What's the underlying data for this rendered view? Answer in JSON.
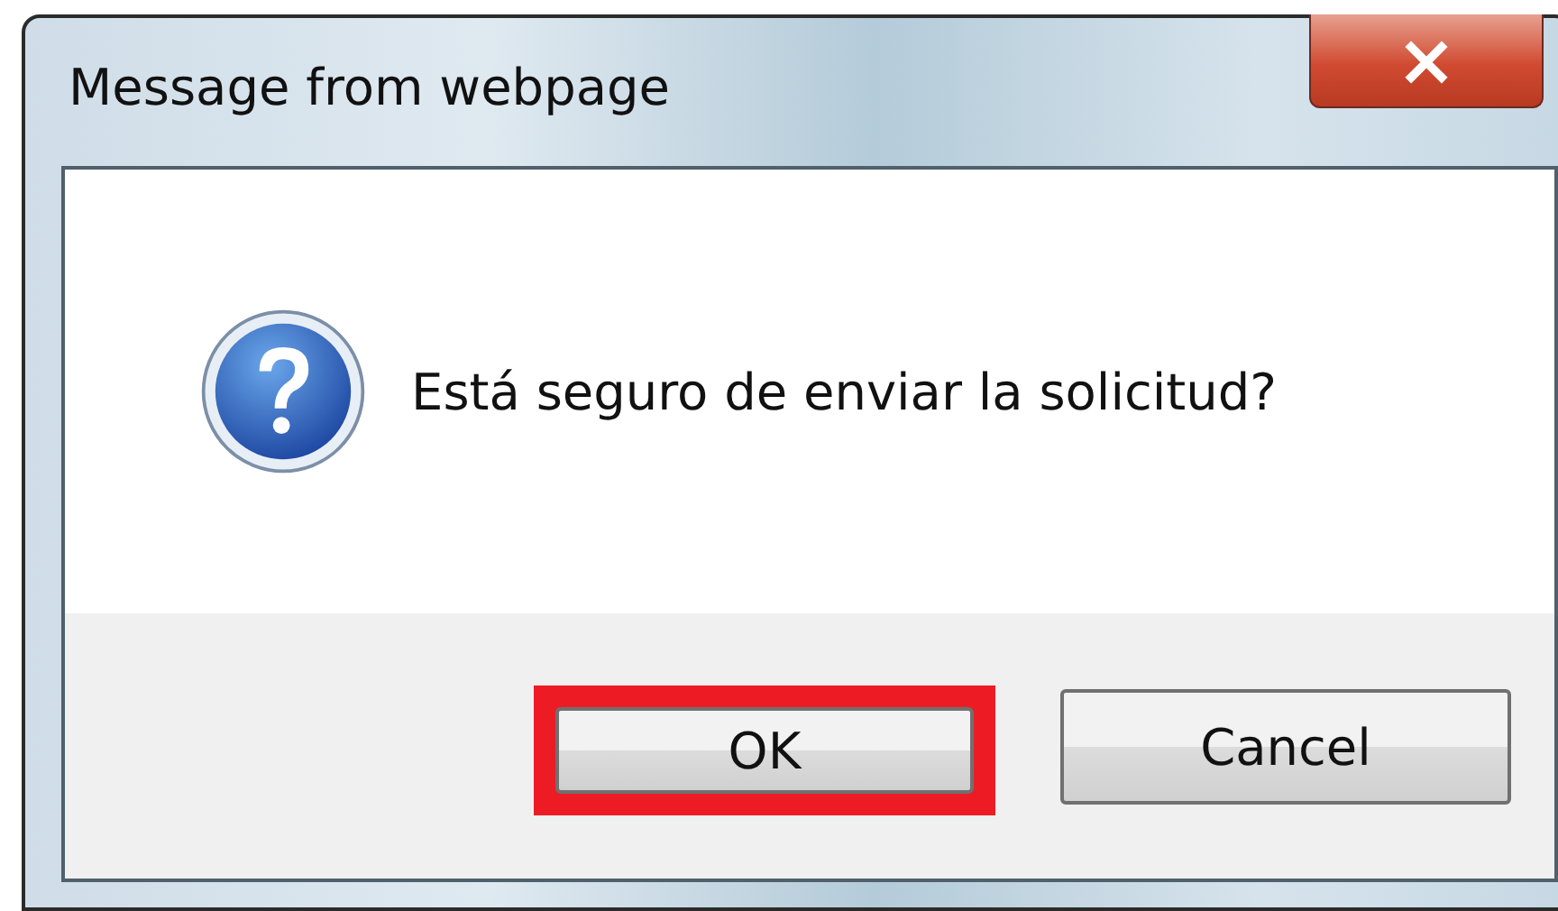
{
  "window": {
    "title": "Message from webpage",
    "close_glyph": "×"
  },
  "message": {
    "text": "Está seguro de enviar la solicitud?"
  },
  "buttons": [
    {
      "label": "OK",
      "highlighted": true
    },
    {
      "label": "Cancel",
      "highlighted": false
    }
  ]
}
